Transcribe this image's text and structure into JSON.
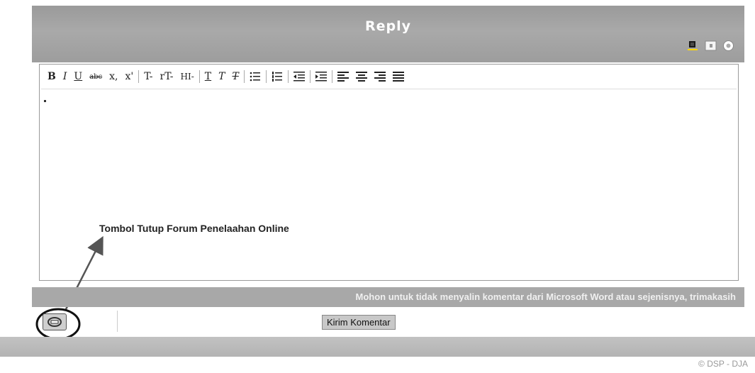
{
  "header": {
    "title": "Reply",
    "icons": [
      "user-icon",
      "document-icon",
      "help-icon"
    ]
  },
  "toolbar": {
    "bold": "B",
    "italic": "I",
    "underline": "U",
    "strikethrough": "abc",
    "subscript": "x,",
    "superscript": "x'",
    "font_size": "T-",
    "font_family": "rT-",
    "heading": "HI-",
    "text_color": "T",
    "highlight": "T",
    "clear_format": "T"
  },
  "annotation": {
    "label": "Tombol Tutup Forum Penelaahan Online"
  },
  "notice": {
    "text": "Mohon untuk tidak menyalin komentar dari Microsoft Word atau sejenisnya, trimakasih"
  },
  "buttons": {
    "submit_label": "Kirim Komentar"
  },
  "footer": {
    "copyright": "© DSP - DJA"
  }
}
